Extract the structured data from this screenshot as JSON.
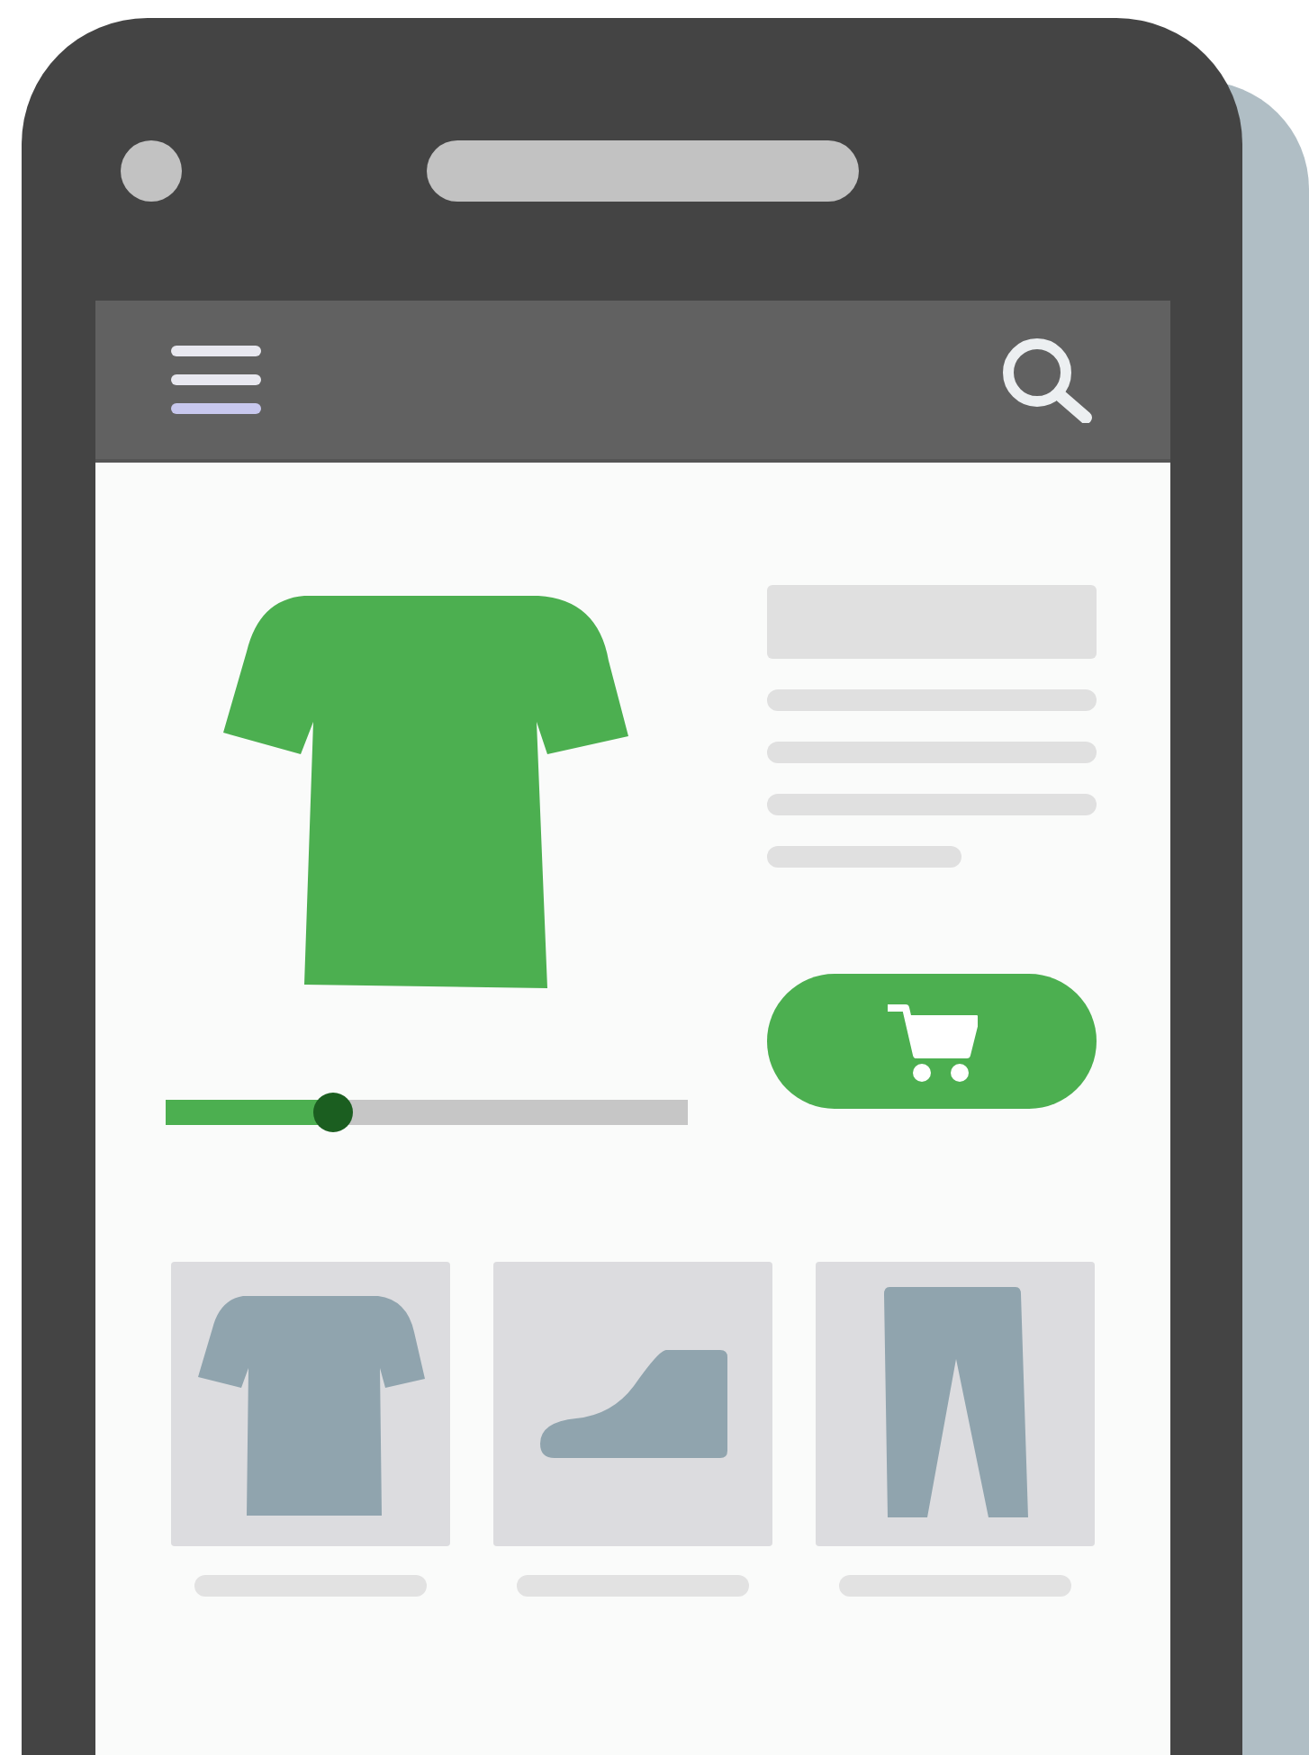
{
  "slider": {
    "level": 0.32
  },
  "thumbnails": [
    {
      "kind": "shirt"
    },
    {
      "kind": "shoe"
    },
    {
      "kind": "pants"
    }
  ]
}
